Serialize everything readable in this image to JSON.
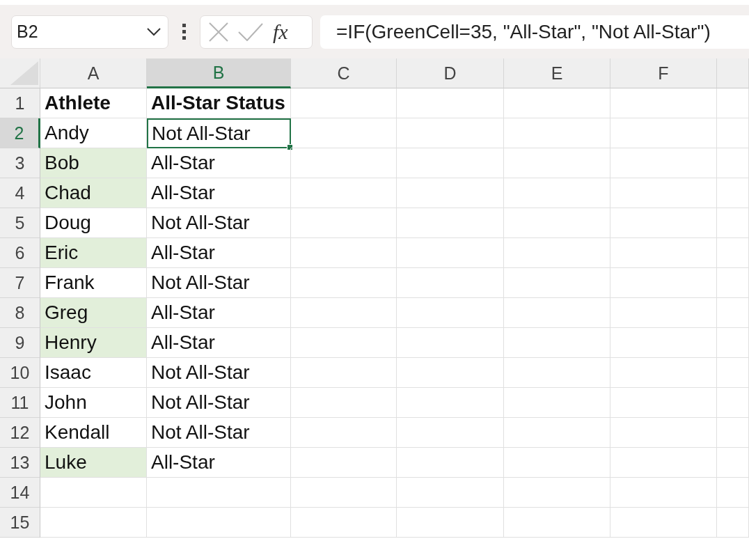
{
  "name_box": {
    "value": "B2"
  },
  "function_button": {
    "label": "fx"
  },
  "formula_bar": {
    "value": "=IF(GreenCell=35, \"All-Star\", \"Not All-Star\")"
  },
  "columns": [
    {
      "label": "A",
      "selected": false
    },
    {
      "label": "B",
      "selected": true
    },
    {
      "label": "C",
      "selected": false
    },
    {
      "label": "D",
      "selected": false
    },
    {
      "label": "E",
      "selected": false
    },
    {
      "label": "F",
      "selected": false
    }
  ],
  "rows": [
    {
      "number": "1",
      "selected": false,
      "cells": [
        {
          "text": "Athlete",
          "bold": true,
          "highlighted": false,
          "selected": false
        },
        {
          "text": "All-Star Status",
          "bold": true,
          "highlighted": false,
          "selected": false
        }
      ]
    },
    {
      "number": "2",
      "selected": true,
      "cells": [
        {
          "text": "Andy",
          "bold": false,
          "highlighted": false,
          "selected": false
        },
        {
          "text": "Not All-Star",
          "bold": false,
          "highlighted": false,
          "selected": true
        }
      ]
    },
    {
      "number": "3",
      "selected": false,
      "cells": [
        {
          "text": "Bob",
          "bold": false,
          "highlighted": true,
          "selected": false
        },
        {
          "text": "All-Star",
          "bold": false,
          "highlighted": false,
          "selected": false
        }
      ]
    },
    {
      "number": "4",
      "selected": false,
      "cells": [
        {
          "text": "Chad",
          "bold": false,
          "highlighted": true,
          "selected": false
        },
        {
          "text": "All-Star",
          "bold": false,
          "highlighted": false,
          "selected": false
        }
      ]
    },
    {
      "number": "5",
      "selected": false,
      "cells": [
        {
          "text": "Doug",
          "bold": false,
          "highlighted": false,
          "selected": false
        },
        {
          "text": "Not All-Star",
          "bold": false,
          "highlighted": false,
          "selected": false
        }
      ]
    },
    {
      "number": "6",
      "selected": false,
      "cells": [
        {
          "text": "Eric",
          "bold": false,
          "highlighted": true,
          "selected": false
        },
        {
          "text": "All-Star",
          "bold": false,
          "highlighted": false,
          "selected": false
        }
      ]
    },
    {
      "number": "7",
      "selected": false,
      "cells": [
        {
          "text": "Frank",
          "bold": false,
          "highlighted": false,
          "selected": false
        },
        {
          "text": "Not All-Star",
          "bold": false,
          "highlighted": false,
          "selected": false
        }
      ]
    },
    {
      "number": "8",
      "selected": false,
      "cells": [
        {
          "text": "Greg",
          "bold": false,
          "highlighted": true,
          "selected": false
        },
        {
          "text": "All-Star",
          "bold": false,
          "highlighted": false,
          "selected": false
        }
      ]
    },
    {
      "number": "9",
      "selected": false,
      "cells": [
        {
          "text": "Henry",
          "bold": false,
          "highlighted": true,
          "selected": false
        },
        {
          "text": "All-Star",
          "bold": false,
          "highlighted": false,
          "selected": false
        }
      ]
    },
    {
      "number": "10",
      "selected": false,
      "cells": [
        {
          "text": "Isaac",
          "bold": false,
          "highlighted": false,
          "selected": false
        },
        {
          "text": "Not All-Star",
          "bold": false,
          "highlighted": false,
          "selected": false
        }
      ]
    },
    {
      "number": "11",
      "selected": false,
      "cells": [
        {
          "text": "John",
          "bold": false,
          "highlighted": false,
          "selected": false
        },
        {
          "text": "Not All-Star",
          "bold": false,
          "highlighted": false,
          "selected": false
        }
      ]
    },
    {
      "number": "12",
      "selected": false,
      "cells": [
        {
          "text": "Kendall",
          "bold": false,
          "highlighted": false,
          "selected": false
        },
        {
          "text": "Not All-Star",
          "bold": false,
          "highlighted": false,
          "selected": false
        }
      ]
    },
    {
      "number": "13",
      "selected": false,
      "cells": [
        {
          "text": "Luke",
          "bold": false,
          "highlighted": true,
          "selected": false
        },
        {
          "text": "All-Star",
          "bold": false,
          "highlighted": false,
          "selected": false
        }
      ]
    },
    {
      "number": "14",
      "selected": false,
      "cells": []
    },
    {
      "number": "15",
      "selected": false,
      "cells": []
    }
  ]
}
